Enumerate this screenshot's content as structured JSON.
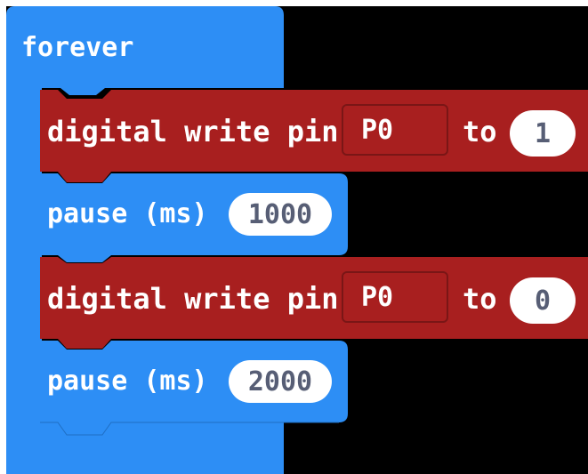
{
  "colors": {
    "loop_block": "#2d8ef5",
    "pins_block": "#a81f1f",
    "workspace": "#000000",
    "input_text": "#575e75"
  },
  "forever_block": {
    "label": "forever"
  },
  "statements": [
    {
      "type": "digital_write",
      "label": "digital write pin",
      "pin": "P0",
      "to_label": "to",
      "value": "1"
    },
    {
      "type": "pause",
      "label": "pause (ms)",
      "value": "1000"
    },
    {
      "type": "digital_write",
      "label": "digital write pin",
      "pin": "P0",
      "to_label": "to",
      "value": "0"
    },
    {
      "type": "pause",
      "label": "pause (ms)",
      "value": "2000"
    }
  ]
}
